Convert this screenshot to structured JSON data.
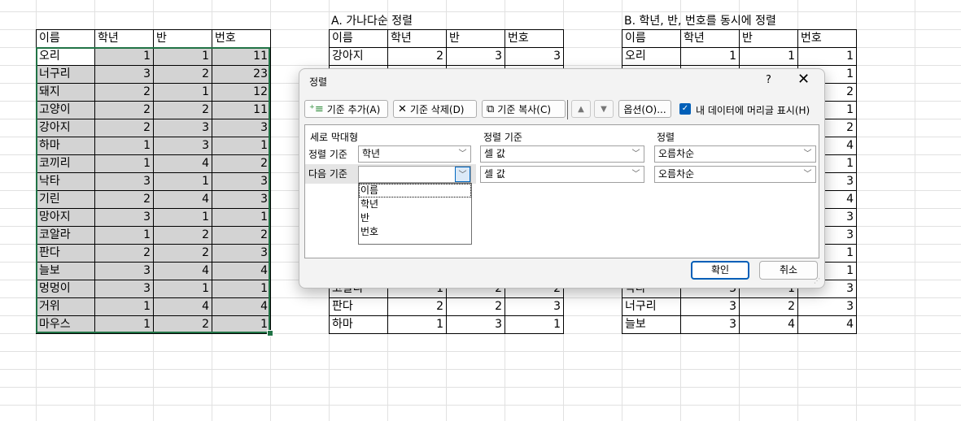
{
  "sheet": {
    "headers": [
      "이름",
      "학년",
      "반",
      "번호"
    ],
    "table_left": [
      [
        "오리",
        "1",
        "1",
        "11"
      ],
      [
        "너구리",
        "3",
        "2",
        "23"
      ],
      [
        "돼지",
        "2",
        "1",
        "12"
      ],
      [
        "고양이",
        "2",
        "2",
        "11"
      ],
      [
        "강아지",
        "2",
        "3",
        "3"
      ],
      [
        "하마",
        "1",
        "3",
        "1"
      ],
      [
        "코끼리",
        "1",
        "4",
        "2"
      ],
      [
        "낙타",
        "3",
        "1",
        "3"
      ],
      [
        "기린",
        "2",
        "4",
        "3"
      ],
      [
        "망아지",
        "3",
        "1",
        "1"
      ],
      [
        "코알라",
        "1",
        "2",
        "2"
      ],
      [
        "판다",
        "2",
        "2",
        "3"
      ],
      [
        "늘보",
        "3",
        "4",
        "4"
      ],
      [
        "멍멍이",
        "3",
        "1",
        "1"
      ],
      [
        "거위",
        "1",
        "4",
        "4"
      ],
      [
        "마우스",
        "1",
        "2",
        "1"
      ]
    ],
    "title_a": "A. 가나다순 정렬",
    "table_a": [
      [
        "강아지",
        "2",
        "3",
        "3"
      ],
      [
        "",
        "",
        "",
        ""
      ],
      [
        "",
        "",
        "",
        ""
      ],
      [
        "",
        "",
        "",
        ""
      ],
      [
        "",
        "",
        "",
        ""
      ],
      [
        "",
        "",
        "",
        ""
      ],
      [
        "",
        "",
        "",
        ""
      ],
      [
        "",
        "",
        "",
        ""
      ],
      [
        "",
        "",
        "",
        ""
      ],
      [
        "",
        "",
        "",
        ""
      ],
      [
        "",
        "",
        "",
        ""
      ],
      [
        "",
        "",
        "",
        ""
      ],
      [
        "",
        "",
        "",
        ""
      ],
      [
        "코알라",
        "1",
        "2",
        "2"
      ],
      [
        "판다",
        "2",
        "2",
        "3"
      ],
      [
        "하마",
        "1",
        "3",
        "1"
      ]
    ],
    "title_b": "B. 학년, 반, 번호를 동시에 정렬",
    "table_b": [
      [
        "오리",
        "1",
        "1",
        "1"
      ],
      [
        "",
        "",
        "",
        "1"
      ],
      [
        "",
        "",
        "",
        "2"
      ],
      [
        "",
        "",
        "",
        "1"
      ],
      [
        "",
        "",
        "",
        "2"
      ],
      [
        "",
        "",
        "",
        "4"
      ],
      [
        "",
        "",
        "",
        "1"
      ],
      [
        "",
        "",
        "",
        "3"
      ],
      [
        "",
        "",
        "",
        "4"
      ],
      [
        "",
        "",
        "",
        "3"
      ],
      [
        "",
        "",
        "",
        "3"
      ],
      [
        "",
        "",
        "",
        "1"
      ],
      [
        "",
        "",
        "",
        "1"
      ],
      [
        "낙타",
        "3",
        "1",
        "3"
      ],
      [
        "너구리",
        "3",
        "2",
        "3"
      ],
      [
        "늘보",
        "3",
        "4",
        "4"
      ]
    ]
  },
  "dialog": {
    "title": "정렬",
    "help": "?",
    "close": "✕",
    "toolbar": {
      "add_label": "기준 추가(A)",
      "delete_label": "기준 삭제(D)",
      "copy_label": "기준 복사(C)",
      "up_icon": "▲",
      "down_icon": "▼",
      "options_label": "옵션(O)...",
      "has_header_label": "내 데이터에 머리글 표시(H)"
    },
    "columns": {
      "column": "세로 막대형",
      "sort_on": "정렬 기준",
      "order": "정렬"
    },
    "rows": [
      {
        "label": "정렬 기준",
        "column": "학년",
        "sort_on": "셀 값",
        "order": "오름차순"
      },
      {
        "label": "다음 기준",
        "column": "",
        "sort_on": "셀 값",
        "order": "오름차순"
      }
    ],
    "dropdown_options": [
      "이름",
      "학년",
      "반",
      "번호"
    ],
    "ok_label": "확인",
    "cancel_label": "취소",
    "accent": "#005fb8"
  }
}
